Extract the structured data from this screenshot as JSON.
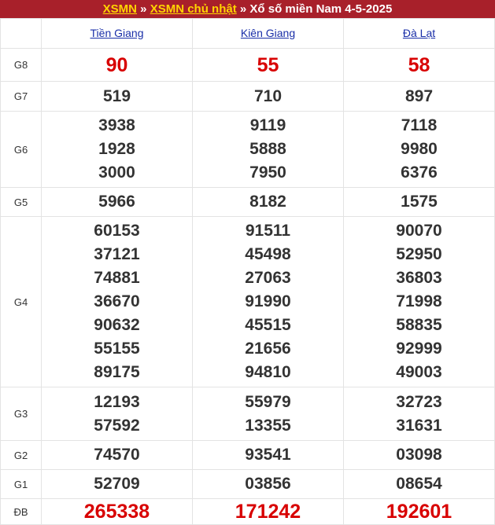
{
  "header": {
    "link1": "XSMN",
    "sep1": " » ",
    "link2": "XSMN chủ nhật",
    "rest": " » Xổ số miền Nam 4-5-2025"
  },
  "provinces": [
    "Tiền Giang",
    "Kiên Giang",
    "Đà Lạt"
  ],
  "rows": [
    {
      "label": "G8",
      "values": [
        [
          "90"
        ],
        [
          "55"
        ],
        [
          "58"
        ]
      ]
    },
    {
      "label": "G7",
      "values": [
        [
          "519"
        ],
        [
          "710"
        ],
        [
          "897"
        ]
      ]
    },
    {
      "label": "G6",
      "values": [
        [
          "3938",
          "1928",
          "3000"
        ],
        [
          "9119",
          "5888",
          "7950"
        ],
        [
          "7118",
          "9980",
          "6376"
        ]
      ]
    },
    {
      "label": "G5",
      "values": [
        [
          "5966"
        ],
        [
          "8182"
        ],
        [
          "1575"
        ]
      ]
    },
    {
      "label": "G4",
      "values": [
        [
          "60153",
          "37121",
          "74881",
          "36670",
          "90632",
          "55155",
          "89175"
        ],
        [
          "91511",
          "45498",
          "27063",
          "91990",
          "45515",
          "21656",
          "94810"
        ],
        [
          "90070",
          "52950",
          "36803",
          "71998",
          "58835",
          "92999",
          "49003"
        ]
      ]
    },
    {
      "label": "G3",
      "values": [
        [
          "12193",
          "57592"
        ],
        [
          "55979",
          "13355"
        ],
        [
          "32723",
          "31631"
        ]
      ]
    },
    {
      "label": "G2",
      "values": [
        [
          "74570"
        ],
        [
          "93541"
        ],
        [
          "03098"
        ]
      ]
    },
    {
      "label": "G1",
      "values": [
        [
          "52709"
        ],
        [
          "03856"
        ],
        [
          "08654"
        ]
      ]
    },
    {
      "label": "ĐB",
      "values": [
        [
          "265338"
        ],
        [
          "171242"
        ],
        [
          "192601"
        ]
      ]
    }
  ],
  "colors": {
    "header_bg": "#a8202a",
    "header_link": "#ffd400",
    "highlight": "#d80000",
    "province_link": "#1a2fa8"
  }
}
